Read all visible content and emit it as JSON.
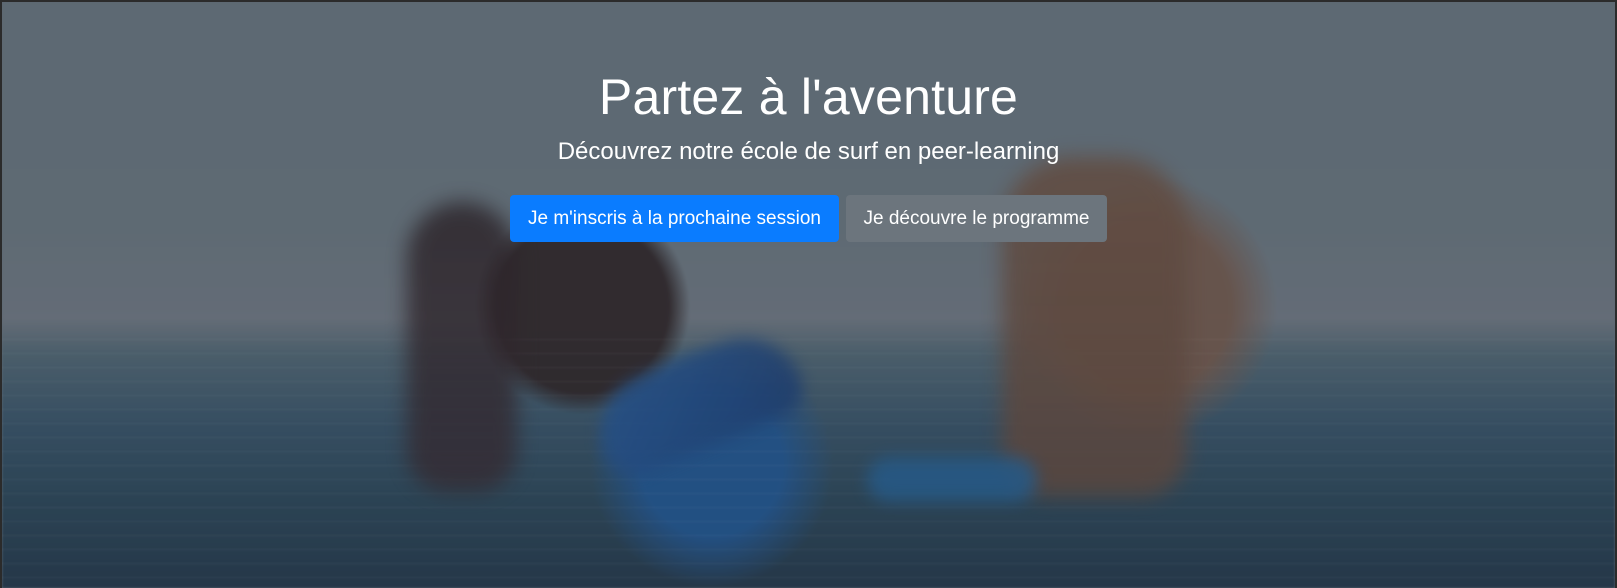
{
  "hero": {
    "title": "Partez à l'aventure",
    "subtitle": "Découvrez notre école de surf en peer-learning",
    "primary_button": "Je m'inscris à la prochaine session",
    "secondary_button": "Je découvre le programme"
  },
  "colors": {
    "primary": "#0a7cff",
    "secondary": "#6c757d",
    "text": "#ffffff"
  }
}
